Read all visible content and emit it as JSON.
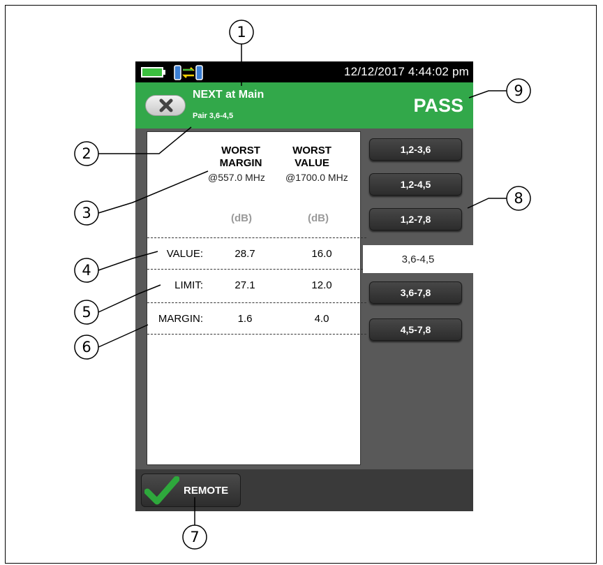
{
  "status_bar": {
    "datetime": "12/12/2017 4:44:02 pm",
    "battery_color": "#3cbf3f"
  },
  "header": {
    "test_name": "NEXT at Main",
    "pair_label": "Pair 3,6-4,5",
    "result": "PASS",
    "color": "#32a84a"
  },
  "table": {
    "columns": [
      {
        "heading_line1": "WORST",
        "heading_line2": "MARGIN",
        "frequency": "@557.0 MHz",
        "unit": "(dB)"
      },
      {
        "heading_line1": "WORST",
        "heading_line2": "VALUE",
        "frequency": "@1700.0 MHz",
        "unit": "(dB)"
      }
    ],
    "rows": [
      {
        "label": "VALUE:",
        "values": [
          "28.7",
          "16.0"
        ]
      },
      {
        "label": "LIMIT:",
        "values": [
          "27.1",
          "12.0"
        ]
      },
      {
        "label": "MARGIN:",
        "values": [
          "1.6",
          "4.0"
        ]
      }
    ]
  },
  "pairs": [
    {
      "label": "1,2-3,6",
      "selected": false
    },
    {
      "label": "1,2-4,5",
      "selected": false
    },
    {
      "label": "1,2-7,8",
      "selected": false
    },
    {
      "label": "3,6-4,5",
      "selected": true
    },
    {
      "label": "3,6-7,8",
      "selected": false
    },
    {
      "label": "4,5-7,8",
      "selected": false
    }
  ],
  "footer": {
    "remote_label": "REMOTE",
    "check_color": "#2ea83c"
  },
  "callouts": [
    "1",
    "2",
    "3",
    "4",
    "5",
    "6",
    "7",
    "8",
    "9"
  ],
  "icons": [
    "battery-icon",
    "link-icon",
    "close-icon",
    "checkmark-icon"
  ]
}
